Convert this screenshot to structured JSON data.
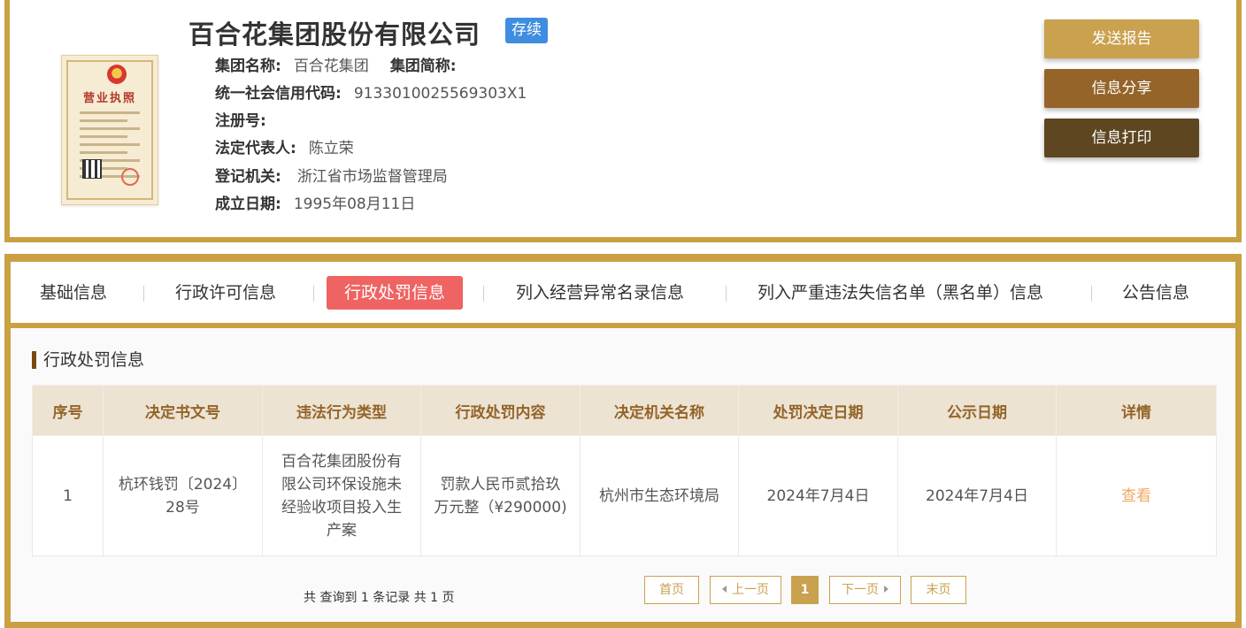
{
  "company": {
    "name": "百合花集团股份有限公司",
    "status": "存续",
    "license_title": "营业执照"
  },
  "info": {
    "group_name_label": "集团名称:",
    "group_name_value": "百合花集团",
    "group_abbr_label": "集团简称:",
    "credit_code_label": "统一社会信用代码:",
    "credit_code_value": "9133010025569303X1",
    "reg_no_label": "注册号:",
    "legal_rep_label": "法定代表人:",
    "legal_rep_value": "陈立荣",
    "authority_label": "登记机关:",
    "authority_value": "浙江省市场监督管理局",
    "founded_label": "成立日期:",
    "founded_value": "1995年08月11日"
  },
  "actions": {
    "send_report": "发送报告",
    "share_info": "信息分享",
    "print_info": "信息打印"
  },
  "colors": {
    "border_gold": "#c9a142",
    "status_blue": "#3f8de0",
    "tab_active": "#ef6363",
    "btn_send": "#c9a14f",
    "btn_share": "#946428",
    "btn_print": "#5e4620",
    "link_orange": "#f0a95f"
  },
  "tabs": [
    {
      "label": "基础信息"
    },
    {
      "label": "行政许可信息"
    },
    {
      "label": "行政处罚信息",
      "active": true
    },
    {
      "label": "列入经营异常名录信息"
    },
    {
      "label": "列入严重违法失信名单（黑名单）信息"
    },
    {
      "label": "公告信息"
    }
  ],
  "section": {
    "title": "行政处罚信息"
  },
  "table": {
    "headers": [
      "序号",
      "决定书文号",
      "违法行为类型",
      "行政处罚内容",
      "决定机关名称",
      "处罚决定日期",
      "公示日期",
      "详情"
    ],
    "rows": [
      {
        "index": "1",
        "doc_no": "杭环钱罚〔2024〕28号",
        "violation_type": "百合花集团股份有限公司环保设施未经验收项目投入生产案",
        "penalty": "罚款人民币贰拾玖万元整（¥290000)",
        "authority": "杭州市生态环境局",
        "decision_date": "2024年7月4日",
        "publish_date": "2024年7月4日",
        "detail": "查看"
      }
    ]
  },
  "pagination": {
    "summary": "共 查询到 1 条记录 共 1 页",
    "first": "首页",
    "prev": "上一页",
    "current": "1",
    "next": "下一页",
    "last": "末页"
  }
}
